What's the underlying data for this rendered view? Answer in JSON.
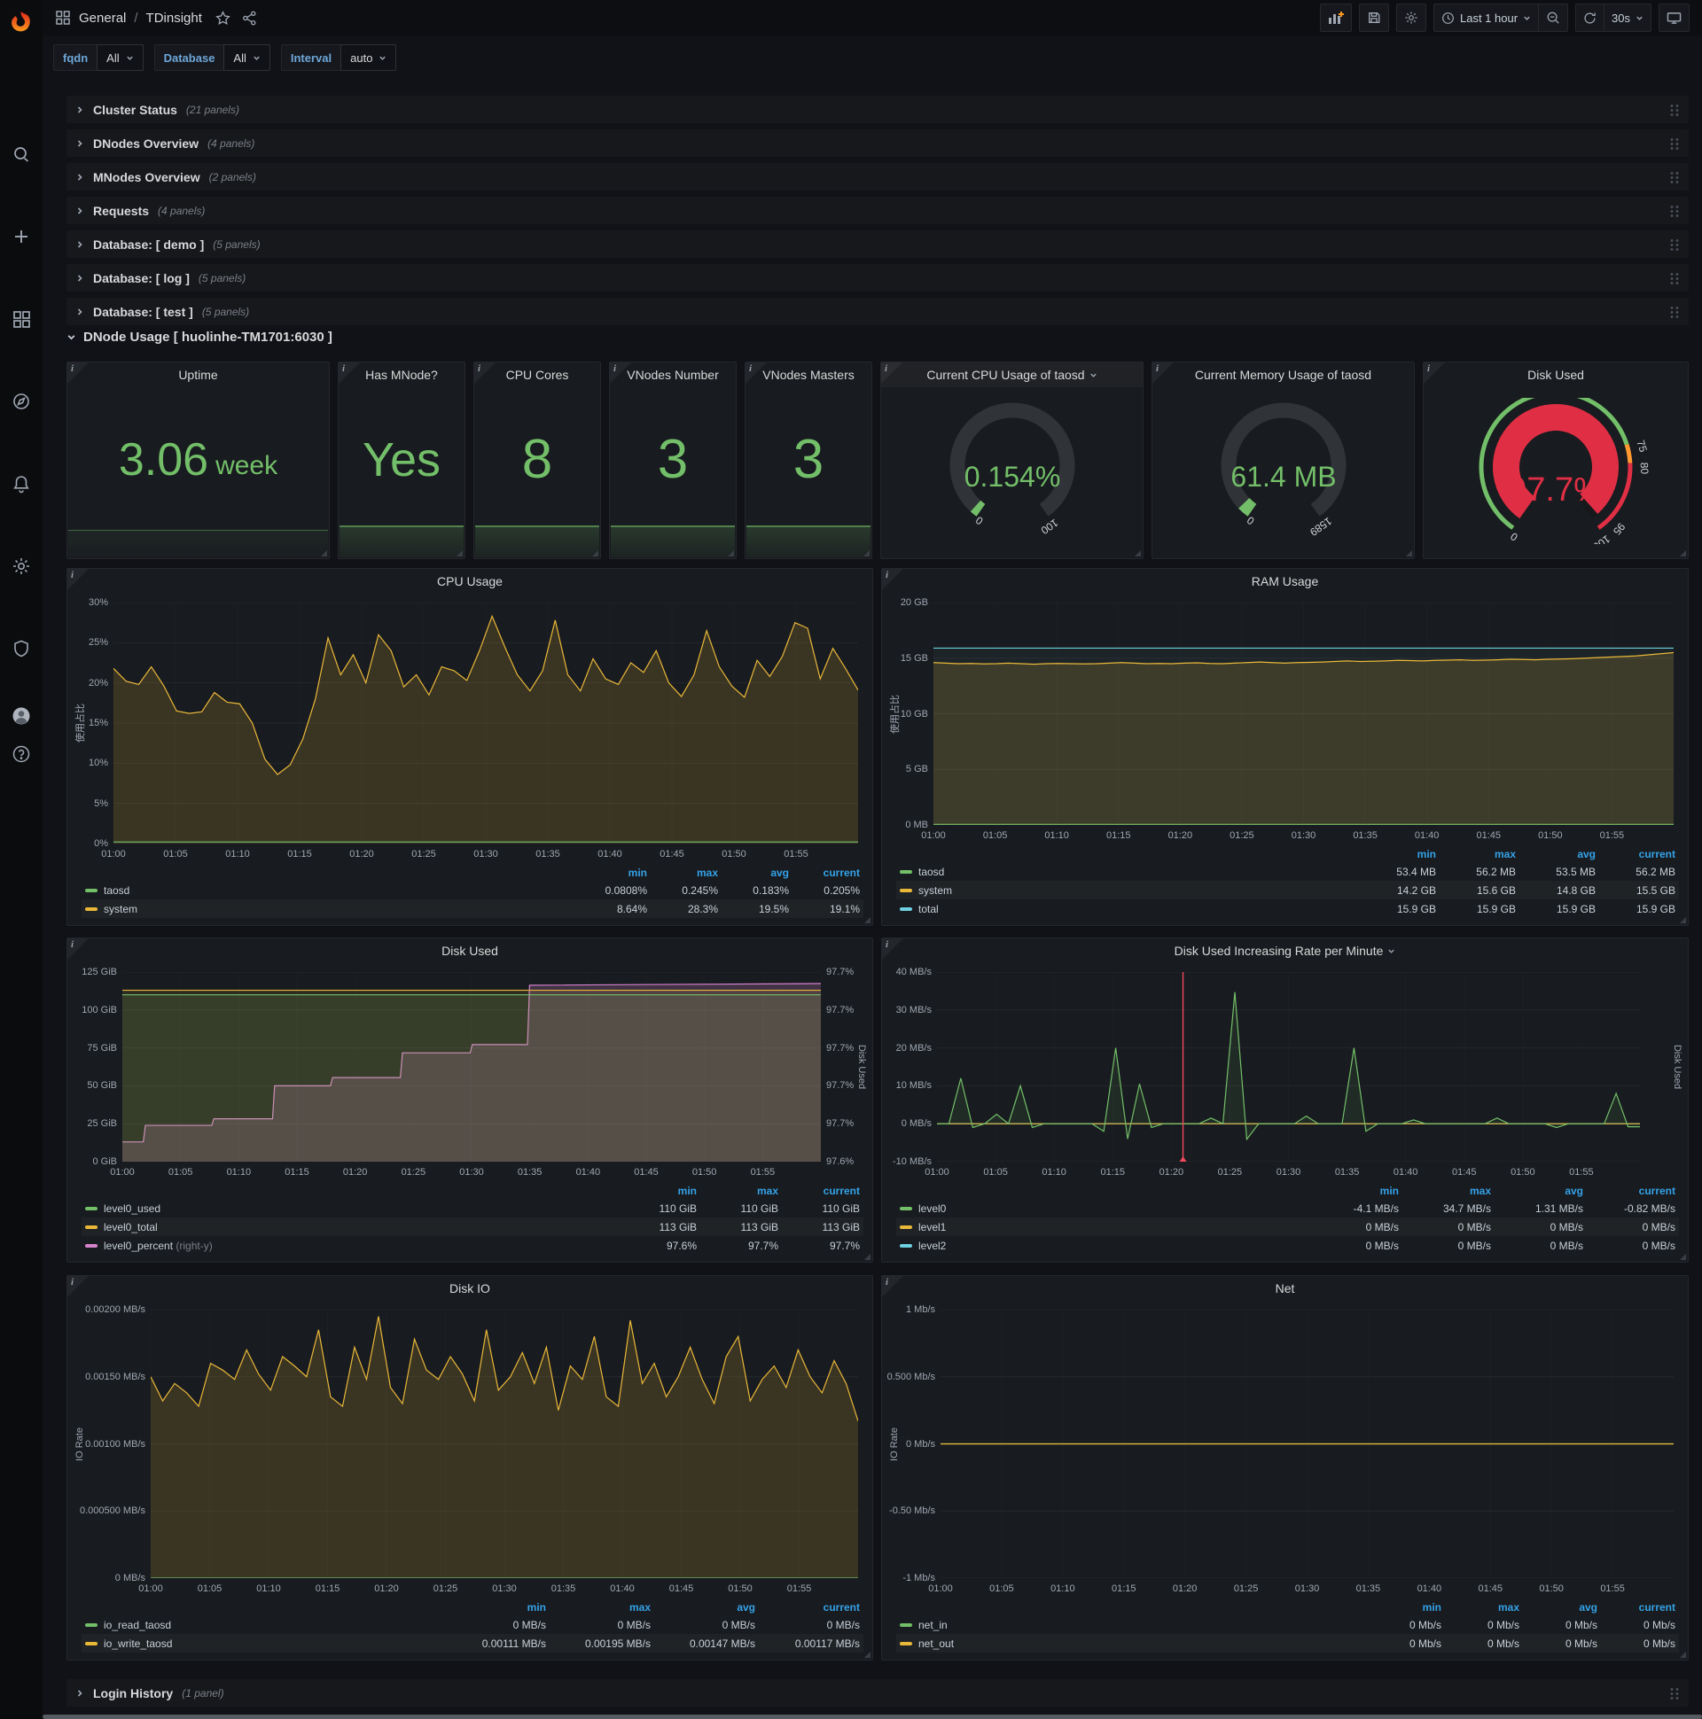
{
  "nav": {
    "breadcrumb": {
      "section": "General",
      "separator": "/",
      "page": "TDinsight"
    },
    "time_range": "Last 1 hour",
    "refresh_interval": "30s"
  },
  "colors": {
    "green": "#73BF69",
    "yellow": "#EAB839",
    "blue": "#35A2E8",
    "red": "#E02F44",
    "orange": "#FF9830",
    "magenta": "#D683CE",
    "cyan": "#6ED0E0"
  },
  "icons": {
    "sidebar": [
      "search-icon",
      "plus-icon",
      "dashboards-icon",
      "explore-icon",
      "alerting-icon",
      "settings-icon",
      "shield-icon",
      "avatar",
      "help-icon"
    ],
    "nav": [
      "apps-icon",
      "star-icon",
      "share-icon",
      "add-panel-icon",
      "save-icon",
      "gear-icon",
      "clock-icon",
      "chevron-down-icon",
      "zoom-out-icon",
      "refresh-icon",
      "display-icon"
    ],
    "row": [
      "chevron-right-icon",
      "chevron-down-icon",
      "drag-handle"
    ],
    "panel": [
      "info-corner-icon"
    ]
  },
  "variables": [
    {
      "label": "fqdn",
      "value": "All"
    },
    {
      "label": "Database",
      "value": "All"
    },
    {
      "label": "Interval",
      "value": "auto"
    }
  ],
  "rows": [
    {
      "title": "Cluster Status",
      "count": "(21 panels)"
    },
    {
      "title": "DNodes Overview",
      "count": "(4 panels)"
    },
    {
      "title": "MNodes Overview",
      "count": "(2 panels)"
    },
    {
      "title": "Requests",
      "count": "(4 panels)"
    },
    {
      "title": "Database: [ demo ]",
      "count": "(5 panels)"
    },
    {
      "title": "Database: [ log ]",
      "count": "(5 panels)"
    },
    {
      "title": "Database: [ test ]",
      "count": "(5 panels)"
    }
  ],
  "expanded_row": {
    "title": "DNode Usage [ huolinhe-TM1701:6030 ]"
  },
  "login_row": {
    "title": "Login History",
    "count": "(1 panel)"
  },
  "stats": [
    {
      "title": "Uptime",
      "value": "3.06",
      "unit": "week"
    },
    {
      "title": "Has MNode?",
      "value": "Yes"
    },
    {
      "title": "CPU Cores",
      "value": "8"
    },
    {
      "title": "VNodes Number",
      "value": "3"
    },
    {
      "title": "VNodes Masters",
      "value": "3"
    }
  ],
  "gauges": [
    {
      "id": "cpu_gauge",
      "title": "Current CPU Usage of taosd",
      "value": "0.154%",
      "fraction": 0.0015,
      "value_color": "#73BF69",
      "style": "simple",
      "dropdown": true,
      "axis_labels": [
        {
          "text": "0",
          "frac": 0
        },
        {
          "text": "100",
          "frac": 1
        }
      ]
    },
    {
      "id": "mem_gauge",
      "title": "Current Memory Usage of taosd",
      "value": "61.4 MB",
      "fraction": 0.0387,
      "value_color": "#73BF69",
      "style": "simple",
      "dropdown": false,
      "axis_labels": [
        {
          "text": "0",
          "frac": 0
        },
        {
          "text": "1589",
          "frac": 1
        }
      ]
    },
    {
      "id": "disk_gauge",
      "title": "Disk Used",
      "value": "97.7%",
      "fraction": 0.977,
      "value_color": "#E02F44",
      "style": "filled",
      "dropdown": false,
      "thresholds": [
        {
          "to": 0.75,
          "color": "#73BF69"
        },
        {
          "to": 0.8,
          "color": "#FF9830"
        },
        {
          "to": 1,
          "color": "#E02F44"
        }
      ],
      "axis_labels": [
        {
          "text": "0",
          "frac": 0
        },
        {
          "text": "75",
          "frac": 0.75
        },
        {
          "text": "80",
          "frac": 0.8
        },
        {
          "text": "95",
          "frac": 0.95
        },
        {
          "text": "100",
          "frac": 1
        }
      ]
    }
  ],
  "chart_data": [
    {
      "id": "cpu",
      "type": "area",
      "title": "CPU Usage",
      "ylabel": "使用占比",
      "ylim": [
        0,
        30
      ],
      "yticks": [
        "0%",
        "5%",
        "10%",
        "15%",
        "20%",
        "25%",
        "30%"
      ],
      "xticks": [
        "01:00",
        "01:05",
        "01:10",
        "01:15",
        "01:20",
        "01:25",
        "01:30",
        "01:35",
        "01:40",
        "01:45",
        "01:50",
        "01:55"
      ],
      "series": [
        {
          "name": "taosd",
          "color": "#73BF69",
          "fill": 0,
          "values": [
            0.2,
            0.2
          ]
        },
        {
          "name": "system",
          "color": "#EAB839",
          "fill": 0.16,
          "values": [
            21.8,
            20.2,
            19.8,
            22,
            19.6,
            16.5,
            16.2,
            16.4,
            18.8,
            17.6,
            17.4,
            15,
            10.5,
            8.6,
            9.8,
            13,
            18,
            25.6,
            21,
            23.5,
            20,
            26,
            24,
            19.5,
            21,
            18.5,
            22,
            21.5,
            20.3,
            24,
            28.3,
            24.5,
            21,
            19,
            21.5,
            27.8,
            21,
            19,
            23,
            20.5,
            19.8,
            22.5,
            21.3,
            24,
            20,
            18.3,
            21,
            26.5,
            22,
            19.6,
            18.2,
            22.8,
            20.8,
            23.3,
            27.5,
            26.8,
            20.5,
            24.3,
            21.8,
            19.1
          ]
        }
      ],
      "legend": {
        "cols": [
          "min",
          "max",
          "avg",
          "current"
        ],
        "rows": [
          {
            "name": "taosd",
            "color": "#73BF69",
            "values": [
              "0.0808%",
              "0.245%",
              "0.183%",
              "0.205%"
            ]
          },
          {
            "name": "system",
            "color": "#EAB839",
            "values": [
              "8.64%",
              "28.3%",
              "19.5%",
              "19.1%"
            ]
          }
        ]
      }
    },
    {
      "id": "ram",
      "type": "area",
      "title": "RAM Usage",
      "ylabel": "使用占比",
      "ylim": [
        0,
        20
      ],
      "yticks": [
        "0 MB",
        "5 GB",
        "10 GB",
        "15 GB",
        "20 GB"
      ],
      "xticks": [
        "01:00",
        "01:05",
        "01:10",
        "01:15",
        "01:20",
        "01:25",
        "01:30",
        "01:35",
        "01:40",
        "01:45",
        "01:50",
        "01:55"
      ],
      "series": [
        {
          "name": "taosd",
          "color": "#73BF69",
          "fill": 0,
          "values": [
            0.055,
            0.055
          ]
        },
        {
          "name": "system",
          "color": "#EAB839",
          "fill": 0.16,
          "values": [
            14.6,
            14.55,
            14.5,
            14.52,
            14.48,
            14.5,
            14.55,
            14.5,
            14.45,
            14.5,
            14.52,
            14.5,
            14.48,
            14.5,
            14.55,
            14.6,
            14.55,
            14.5,
            14.52,
            14.5,
            14.55,
            14.58,
            14.52,
            14.5,
            14.55,
            14.6,
            14.65,
            14.6,
            14.55,
            14.6,
            14.62,
            14.65,
            14.7,
            14.75,
            14.7,
            14.72,
            14.75,
            14.8,
            14.78,
            14.75,
            14.8,
            14.82,
            14.85,
            14.8,
            14.82,
            14.85,
            14.9,
            14.88,
            14.85,
            14.9,
            14.92,
            14.95,
            15,
            15.05,
            15.1,
            15.15,
            15.2,
            15.3,
            15.4,
            15.5
          ]
        },
        {
          "name": "total",
          "color": "#6ED0E0",
          "fill": 0.05,
          "values": [
            15.9,
            15.9
          ]
        }
      ],
      "legend": {
        "cols": [
          "min",
          "max",
          "avg",
          "current"
        ],
        "rows": [
          {
            "name": "taosd",
            "color": "#73BF69",
            "values": [
              "53.4 MB",
              "56.2 MB",
              "53.5 MB",
              "56.2 MB"
            ]
          },
          {
            "name": "system",
            "color": "#EAB839",
            "values": [
              "14.2 GB",
              "15.6 GB",
              "14.8 GB",
              "15.5 GB"
            ]
          },
          {
            "name": "total",
            "color": "#6ED0E0",
            "values": [
              "15.9 GB",
              "15.9 GB",
              "15.9 GB",
              "15.9 GB"
            ]
          }
        ]
      }
    },
    {
      "id": "disk",
      "type": "area",
      "title": "Disk Used",
      "ylabel": "",
      "ylabel_right": "Disk Used",
      "ylim": [
        0,
        125
      ],
      "yticks": [
        "0 GiB",
        "25 GiB",
        "50 GiB",
        "75 GiB",
        "100 GiB",
        "125 GiB"
      ],
      "yticks_right": [
        "97.6%",
        "97.7%",
        "97.7%",
        "97.7%",
        "97.7%",
        "97.7%"
      ],
      "xticks": [
        "01:00",
        "01:05",
        "01:10",
        "01:15",
        "01:20",
        "01:25",
        "01:30",
        "01:35",
        "01:40",
        "01:45",
        "01:50",
        "01:55"
      ],
      "series": [
        {
          "name": "level0_used",
          "color": "#73BF69",
          "fill": 0.13,
          "values": [
            110,
            110
          ]
        },
        {
          "name": "level0_total",
          "color": "#EAB839",
          "fill": 0.1,
          "values": [
            113,
            113
          ]
        },
        {
          "name": "level0_percent",
          "color": "#D683CE",
          "fill": 0.22,
          "ylim": [
            97.588,
            97.703
          ],
          "x": [
            0,
            0.03,
            0.033,
            0.128,
            0.131,
            0.215,
            0.218,
            0.298,
            0.301,
            0.398,
            0.401,
            0.498,
            0.501,
            0.58,
            0.583,
            1
          ],
          "values": [
            97.6,
            97.6,
            97.61,
            97.61,
            97.614,
            97.614,
            97.634,
            97.634,
            97.639,
            97.639,
            97.654,
            97.654,
            97.659,
            97.659,
            97.695,
            97.696
          ]
        }
      ],
      "legend": {
        "cols": [
          "min",
          "max",
          "current"
        ],
        "rows": [
          {
            "name": "level0_used",
            "color": "#73BF69",
            "values": [
              "110 GiB",
              "110 GiB",
              "110 GiB"
            ]
          },
          {
            "name": "level0_total",
            "color": "#EAB839",
            "values": [
              "113 GiB",
              "113 GiB",
              "113 GiB"
            ]
          },
          {
            "name": "level0_percent",
            "suffix": "(right-y)",
            "color": "#D683CE",
            "values": [
              "97.6%",
              "97.7%",
              "97.7%"
            ]
          }
        ]
      }
    },
    {
      "id": "rate",
      "type": "line",
      "title": "Disk Used Increasing Rate per Minute",
      "dropdown": true,
      "ylabel": "",
      "ylabel_right": "Disk Used",
      "ylim": [
        -10,
        40
      ],
      "yticks": [
        "-10 MB/s",
        "0 MB/s",
        "10 MB/s",
        "20 MB/s",
        "30 MB/s",
        "40 MB/s"
      ],
      "xticks": [
        "01:00",
        "01:05",
        "01:10",
        "01:15",
        "01:20",
        "01:25",
        "01:30",
        "01:35",
        "01:40",
        "01:45",
        "01:50",
        "01:55"
      ],
      "annotation_x": 0.35,
      "annotation_color": "#F2495C",
      "series": [
        {
          "name": "level0",
          "color": "#73BF69",
          "fill": 0.1,
          "values": [
            0,
            0,
            12,
            -1,
            0,
            2.5,
            0,
            10,
            -1,
            0,
            0,
            0,
            0,
            0,
            -2,
            20,
            -4,
            10.5,
            -1,
            0,
            0,
            0,
            0,
            1.5,
            0,
            34.7,
            -4.1,
            0,
            0,
            0,
            0,
            2,
            0,
            0,
            0,
            20,
            -2,
            0,
            0,
            0,
            1,
            0,
            0,
            0,
            0,
            0,
            0,
            1.5,
            0,
            0,
            0,
            0,
            -1,
            0,
            0,
            0,
            0,
            8,
            -0.8,
            -0.8
          ]
        },
        {
          "name": "level1",
          "color": "#EAB839",
          "fill": 0,
          "values": [
            0,
            0
          ]
        },
        {
          "name": "level2",
          "color": "#6ED0E0",
          "fill": 0,
          "values": [
            0,
            0
          ]
        }
      ],
      "legend": {
        "cols": [
          "min",
          "max",
          "avg",
          "current"
        ],
        "rows": [
          {
            "name": "level0",
            "color": "#73BF69",
            "values": [
              "-4.1 MB/s",
              "34.7 MB/s",
              "1.31 MB/s",
              "-0.82 MB/s"
            ]
          },
          {
            "name": "level1",
            "color": "#EAB839",
            "values": [
              "0 MB/s",
              "0 MB/s",
              "0 MB/s",
              "0 MB/s"
            ]
          },
          {
            "name": "level2",
            "color": "#6ED0E0",
            "values": [
              "0 MB/s",
              "0 MB/s",
              "0 MB/s",
              "0 MB/s"
            ]
          }
        ]
      }
    },
    {
      "id": "io",
      "type": "area",
      "title": "Disk IO",
      "ylabel": "IO Rate",
      "ylim": [
        0,
        0.002
      ],
      "yticks": [
        "0 MB/s",
        "0.000500 MB/s",
        "0.00100 MB/s",
        "0.00150 MB/s",
        "0.00200 MB/s"
      ],
      "xticks": [
        "01:00",
        "01:05",
        "01:10",
        "01:15",
        "01:20",
        "01:25",
        "01:30",
        "01:35",
        "01:40",
        "01:45",
        "01:50",
        "01:55"
      ],
      "series": [
        {
          "name": "io_read_taosd",
          "color": "#73BF69",
          "fill": 0,
          "values": [
            0,
            0
          ]
        },
        {
          "name": "io_write_taosd",
          "color": "#EAB839",
          "fill": 0.16,
          "values": [
            0.0015,
            0.00132,
            0.00145,
            0.00138,
            0.00128,
            0.0016,
            0.00155,
            0.00148,
            0.0017,
            0.00152,
            0.0014,
            0.00165,
            0.00158,
            0.0015,
            0.00185,
            0.00135,
            0.00128,
            0.00172,
            0.00148,
            0.00195,
            0.00142,
            0.0013,
            0.00178,
            0.00155,
            0.00148,
            0.00165,
            0.00152,
            0.00132,
            0.00185,
            0.0014,
            0.0015,
            0.00168,
            0.00145,
            0.00172,
            0.00125,
            0.00158,
            0.00148,
            0.0018,
            0.00135,
            0.00128,
            0.00192,
            0.00145,
            0.0016,
            0.00135,
            0.0015,
            0.00172,
            0.00148,
            0.0013,
            0.00165,
            0.0018,
            0.00132,
            0.00148,
            0.00158,
            0.00142,
            0.0017,
            0.0015,
            0.00138,
            0.00162,
            0.00145,
            0.00117
          ]
        }
      ],
      "legend": {
        "cols": [
          "min",
          "max",
          "avg",
          "current"
        ],
        "rows": [
          {
            "name": "io_read_taosd",
            "color": "#73BF69",
            "values": [
              "0 MB/s",
              "0 MB/s",
              "0 MB/s",
              "0 MB/s"
            ]
          },
          {
            "name": "io_write_taosd",
            "color": "#EAB839",
            "values": [
              "0.00111 MB/s",
              "0.00195 MB/s",
              "0.00147 MB/s",
              "0.00117 MB/s"
            ]
          }
        ]
      }
    },
    {
      "id": "net",
      "type": "line",
      "title": "Net",
      "ylabel": "IO Rate",
      "ylim": [
        -1,
        1
      ],
      "yticks": [
        "-1 Mb/s",
        "-0.50 Mb/s",
        "0 Mb/s",
        "0.500 Mb/s",
        "1 Mb/s"
      ],
      "xticks": [
        "01:00",
        "01:05",
        "01:10",
        "01:15",
        "01:20",
        "01:25",
        "01:30",
        "01:35",
        "01:40",
        "01:45",
        "01:50",
        "01:55"
      ],
      "series": [
        {
          "name": "net_out",
          "color": "#EAB839",
          "fill": 0,
          "values": [
            0,
            0
          ]
        },
        {
          "name": "net_in",
          "color": "#73BF69",
          "fill": 0,
          "values": [
            0,
            0
          ]
        }
      ],
      "legend": {
        "cols": [
          "min",
          "max",
          "avg",
          "current"
        ],
        "rows": [
          {
            "name": "net_in",
            "color": "#73BF69",
            "values": [
              "0 Mb/s",
              "0 Mb/s",
              "0 Mb/s",
              "0 Mb/s"
            ]
          },
          {
            "name": "net_out",
            "color": "#EAB839",
            "values": [
              "0 Mb/s",
              "0 Mb/s",
              "0 Mb/s",
              "0 Mb/s"
            ]
          }
        ]
      }
    }
  ]
}
